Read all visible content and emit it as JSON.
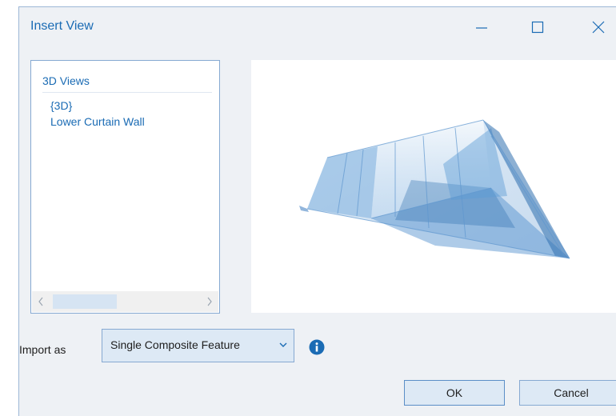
{
  "window": {
    "title": "Insert View",
    "minimize_icon": "minimize-icon",
    "maximize_icon": "maximize-icon",
    "close_icon": "close-icon"
  },
  "view_list": {
    "header": "3D Views",
    "items": [
      "{3D}",
      "Lower Curtain Wall"
    ]
  },
  "import": {
    "label": "Import as",
    "selected": "Single Composite Feature",
    "info_icon": "info-icon"
  },
  "buttons": {
    "ok": "OK",
    "cancel": "Cancel"
  },
  "colors": {
    "accent": "#1a6bb4",
    "dialog_bg": "#eef1f5",
    "button_bg": "#dde9f5",
    "border": "#86a9d2",
    "glass": "#6fa3d6"
  }
}
